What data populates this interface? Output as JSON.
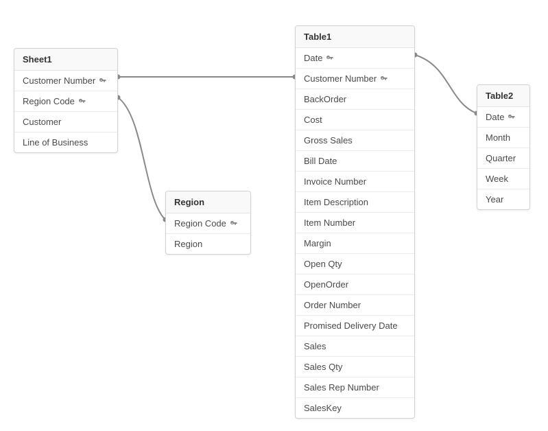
{
  "tables": {
    "sheet1": {
      "title": "Sheet1",
      "fields": [
        {
          "name": "Customer Number",
          "key": true
        },
        {
          "name": "Region Code",
          "key": true
        },
        {
          "name": "Customer",
          "key": false
        },
        {
          "name": "Line of Business",
          "key": false
        }
      ]
    },
    "region": {
      "title": "Region",
      "fields": [
        {
          "name": "Region Code",
          "key": true
        },
        {
          "name": "Region",
          "key": false
        }
      ]
    },
    "table1": {
      "title": "Table1",
      "fields": [
        {
          "name": "Date",
          "key": true
        },
        {
          "name": "Customer Number",
          "key": true
        },
        {
          "name": "BackOrder",
          "key": false
        },
        {
          "name": "Cost",
          "key": false
        },
        {
          "name": "Gross Sales",
          "key": false
        },
        {
          "name": "Bill Date",
          "key": false
        },
        {
          "name": "Invoice Number",
          "key": false
        },
        {
          "name": "Item Description",
          "key": false
        },
        {
          "name": "Item Number",
          "key": false
        },
        {
          "name": "Margin",
          "key": false
        },
        {
          "name": "Open Qty",
          "key": false
        },
        {
          "name": "OpenOrder",
          "key": false
        },
        {
          "name": "Order Number",
          "key": false
        },
        {
          "name": "Promised Delivery Date",
          "key": false
        },
        {
          "name": "Sales",
          "key": false
        },
        {
          "name": "Sales Qty",
          "key": false
        },
        {
          "name": "Sales Rep Number",
          "key": false
        },
        {
          "name": "SalesKey",
          "key": false
        }
      ]
    },
    "table2": {
      "title": "Table2",
      "fields": [
        {
          "name": "Date",
          "key": true
        },
        {
          "name": "Month",
          "key": false
        },
        {
          "name": "Quarter",
          "key": false
        },
        {
          "name": "Week",
          "key": false
        },
        {
          "name": "Year",
          "key": false
        }
      ]
    }
  },
  "connections": [
    {
      "from": "sheet1.Customer Number",
      "to": "table1.Customer Number"
    },
    {
      "from": "sheet1.Region Code",
      "to": "region.Region Code"
    },
    {
      "from": "table1.Date",
      "to": "table2.Date"
    }
  ],
  "colors": {
    "line": "#8a8a8a",
    "border": "#d2d2d2",
    "text": "#4a4a4a",
    "header_bg": "#f9f9f9"
  }
}
